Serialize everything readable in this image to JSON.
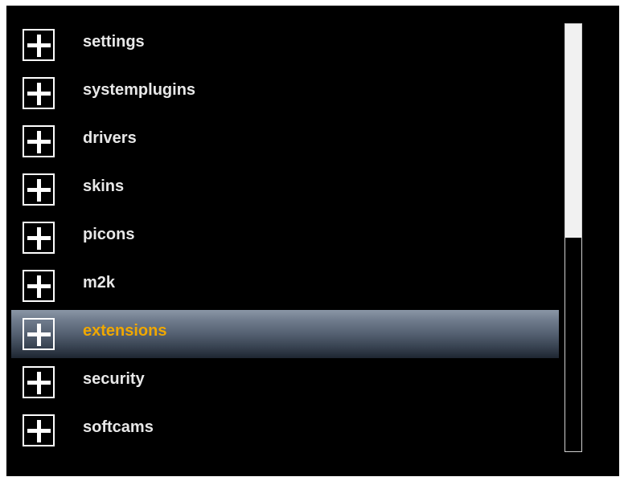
{
  "menu": {
    "selected_index": 6,
    "items": [
      {
        "label": "settings",
        "icon": "plus-icon"
      },
      {
        "label": "systemplugins",
        "icon": "plus-icon"
      },
      {
        "label": "drivers",
        "icon": "plus-icon"
      },
      {
        "label": "skins",
        "icon": "plus-icon"
      },
      {
        "label": "picons",
        "icon": "plus-icon"
      },
      {
        "label": "m2k",
        "icon": "plus-icon"
      },
      {
        "label": "extensions",
        "icon": "plus-icon"
      },
      {
        "label": "security",
        "icon": "plus-icon"
      },
      {
        "label": "softcams",
        "icon": "plus-icon"
      }
    ]
  },
  "scrollbar": {
    "position_fraction": 0.0,
    "visible_fraction": 0.5
  },
  "colors": {
    "background": "#000000",
    "text": "#e8e8e8",
    "selected_text": "#f0a800",
    "selection_bar_top": "#8a96a6",
    "selection_bar_bottom": "#1e2631"
  }
}
